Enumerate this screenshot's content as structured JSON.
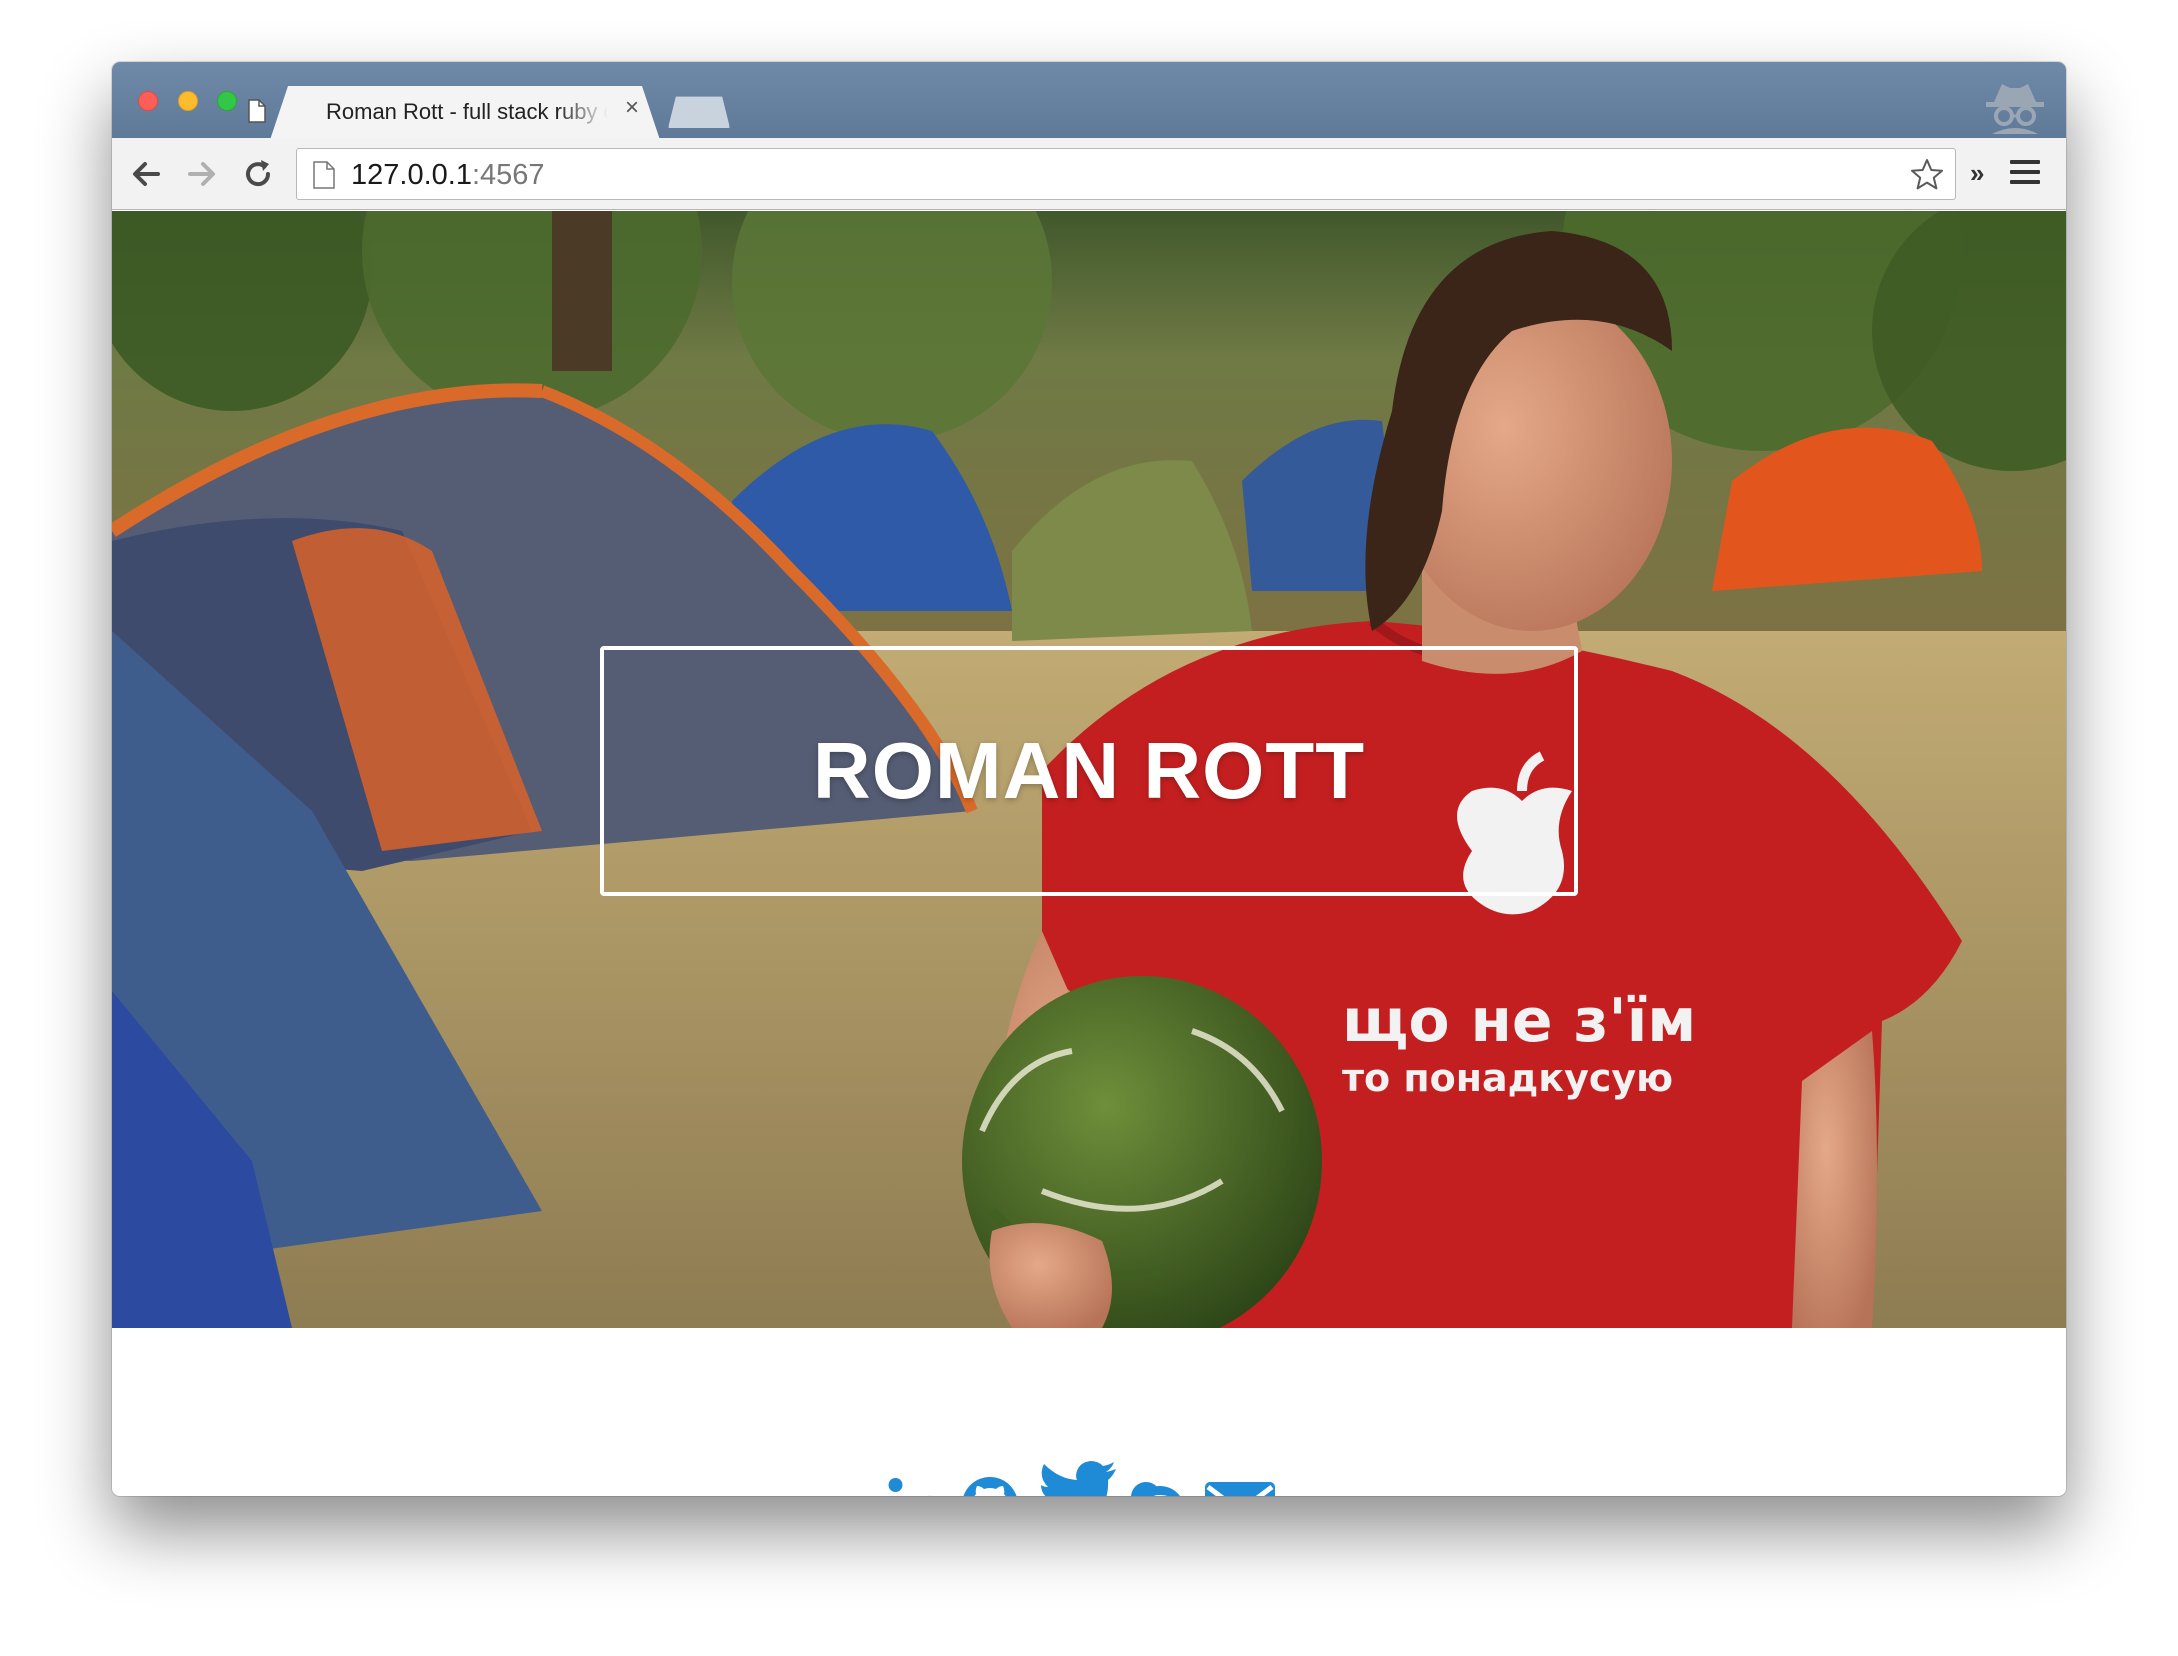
{
  "browser": {
    "tab": {
      "title": "Roman Rott - full stack ruby developer",
      "close_glyph": "×"
    },
    "address_bar": {
      "host": "127.0.0.1",
      "port": ":4567"
    },
    "overflow_glyph": "»",
    "icons": [
      "back-arrow-icon",
      "forward-arrow-icon",
      "reload-icon",
      "page-icon",
      "bookmark-star-icon",
      "menu-icon",
      "incognito-icon"
    ]
  },
  "hero": {
    "name": "ROMAN ROTT",
    "photo_description_colors": {
      "shirt": "#c81e1e",
      "grass": "#a89460",
      "tent_blue": "#3d5a8a",
      "tent_orange": "#e2561d"
    }
  },
  "social": {
    "accent_color": "#1f8ad6",
    "links": [
      "linkedin-icon",
      "github-icon",
      "twitter-icon",
      "skype-icon",
      "email-icon"
    ]
  }
}
